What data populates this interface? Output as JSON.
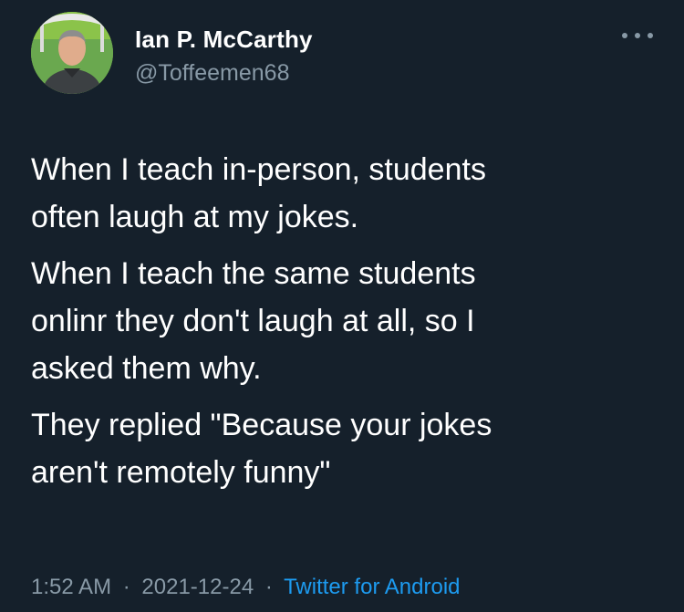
{
  "tweet": {
    "author": {
      "name": "Ian P. McCarthy",
      "handle": "@Toffeemen68"
    },
    "paragraphs": [
      "When I teach in-person, students\noften laugh at my jokes.",
      "When I teach the same students\nonlinr they don't laugh at all, so I\nasked them why.",
      "They replied \"Because your jokes\naren't remotely funny\""
    ],
    "meta": {
      "time": "1:52 AM",
      "separator": "·",
      "date": "2021-12-24",
      "source": "Twitter for Android"
    }
  },
  "icons": {
    "more": "more-horizontal-icon"
  },
  "colors": {
    "background": "#15202b",
    "text": "#ffffff",
    "secondary": "#8899a6",
    "link": "#1d9bf0"
  }
}
